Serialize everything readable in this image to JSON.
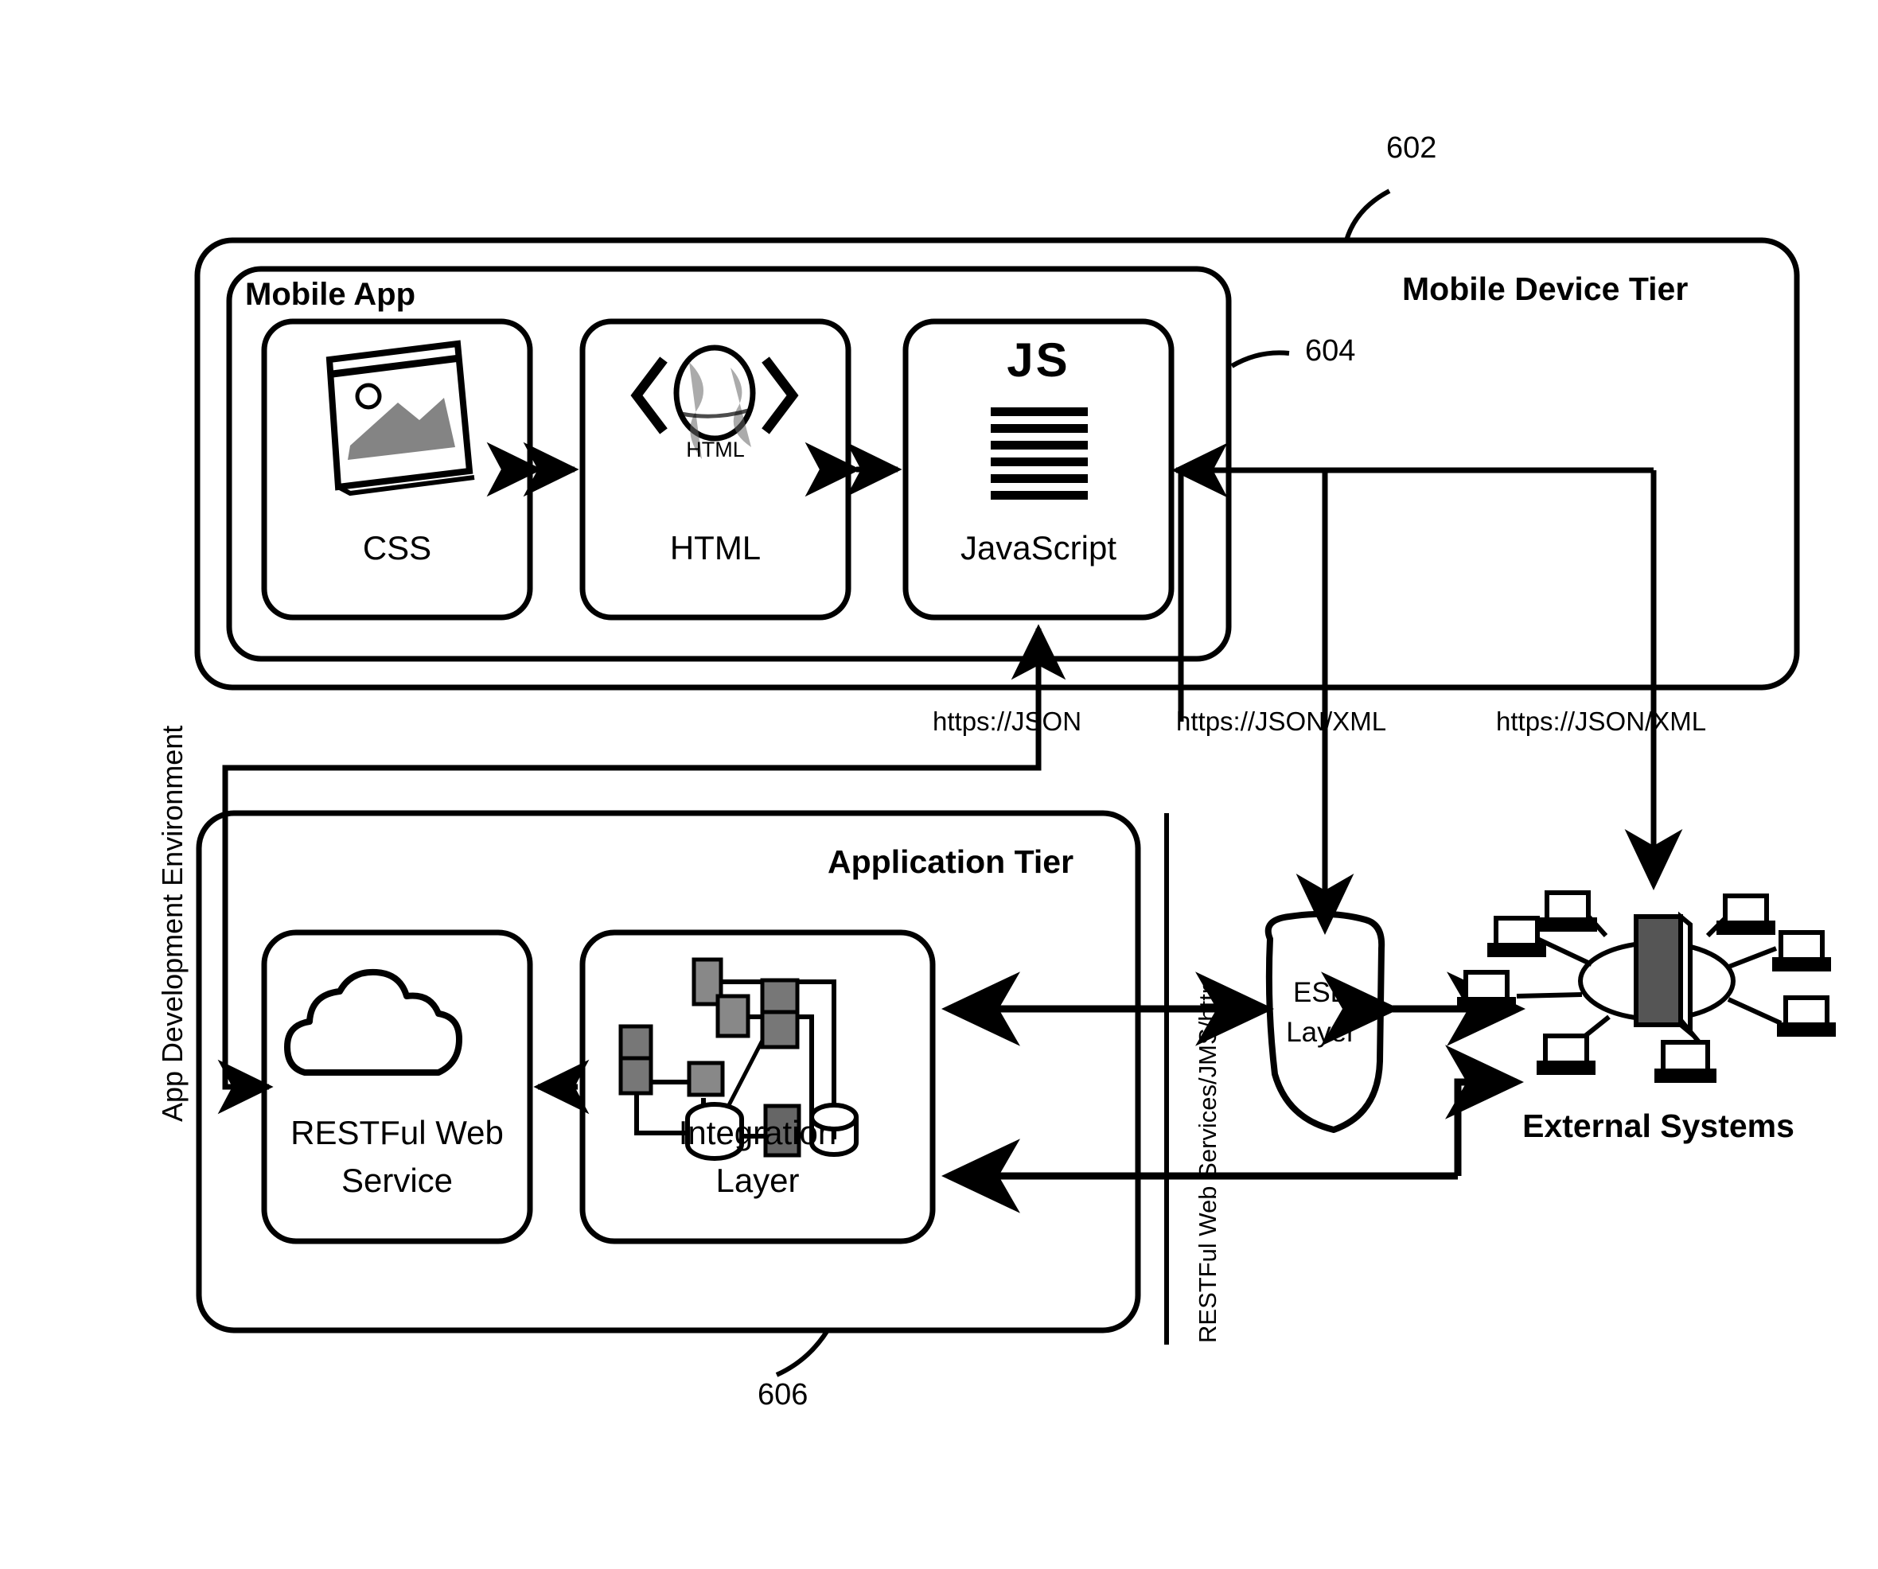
{
  "figure": {
    "vertical_left_label": "App Development Environment",
    "vertical_right_label": "RESTFul Web Services/JMS/http"
  },
  "refs": {
    "outer_tier": "602",
    "mobile_app": "604",
    "app_tier": "606"
  },
  "mobile_device_tier": {
    "title": "Mobile Device Tier",
    "mobile_app": {
      "title": "Mobile App",
      "boxes": [
        {
          "label": "CSS",
          "icon": "css-image-icon",
          "sub": ""
        },
        {
          "label": "HTML",
          "icon": "html-globe-icon",
          "sub": "HTML"
        },
        {
          "label": "JavaScript",
          "icon": "js-script-icon",
          "sub": "JS"
        }
      ]
    }
  },
  "application_tier": {
    "title": "Application Tier",
    "boxes": [
      {
        "label_line1": "RESTFul Web",
        "label_line2": "Service",
        "icon": "cloud-icon"
      },
      {
        "label_line1": "Integration",
        "label_line2": "Layer",
        "icon": "integration-network-icon"
      }
    ]
  },
  "esb": {
    "line1": "ESB",
    "line2": "Layer"
  },
  "external": {
    "label": "External Systems",
    "icon": "network-computers-icon"
  },
  "protocols": [
    "https://JSON",
    "https://JSON/XML",
    "https://JSON/XML"
  ],
  "colors": {
    "stroke": "#000000",
    "background": "#ffffff"
  }
}
